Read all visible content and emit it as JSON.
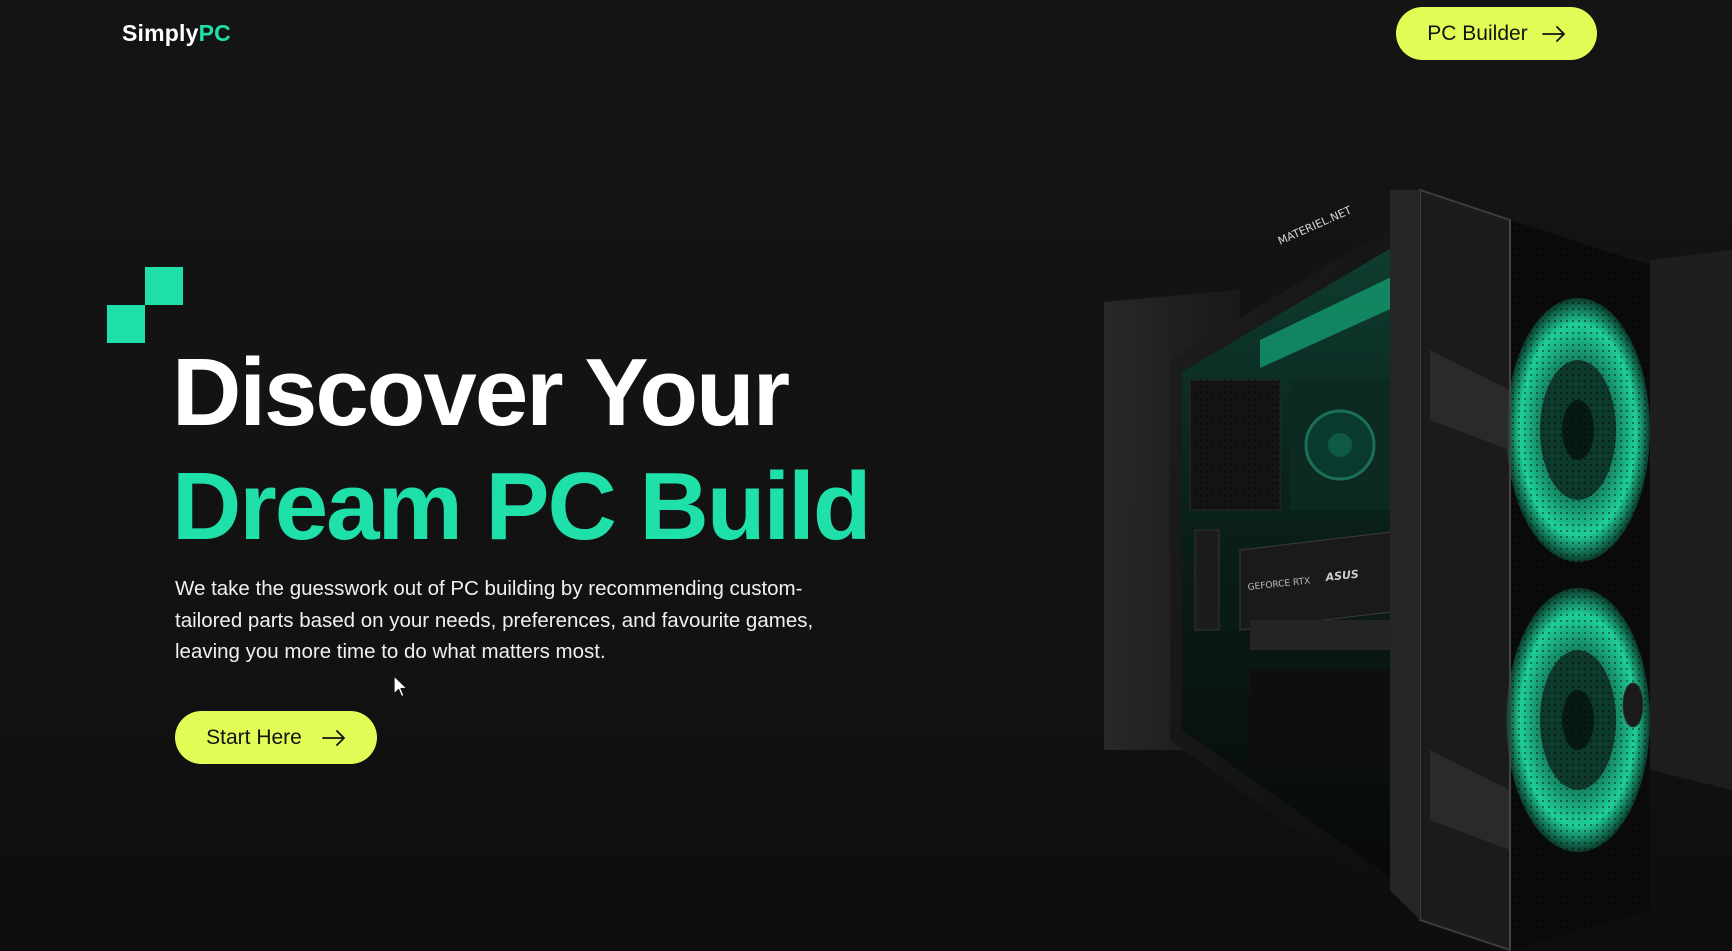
{
  "header": {
    "logo_part1": "Simply",
    "logo_part2": "PC",
    "nav_button_label": "PC Builder"
  },
  "hero": {
    "title_line1": "Discover Your",
    "title_line2": "Dream PC Build",
    "description": "We take the guesswork out of PC building by recommending custom-tailored parts based on your needs, preferences, and favourite games, leaving you more time to do what matters most.",
    "cta_label": "Start Here"
  },
  "pc_image": {
    "top_label": "MATERIEL.NET",
    "gpu_label1": "GEFORCE RTX",
    "gpu_label2": "ASUS"
  },
  "colors": {
    "background": "#131313",
    "accent_green": "#1fe0a8",
    "button_yellow": "#e2fb55",
    "text_white": "#ffffff"
  },
  "icons": {
    "nav_arrow": "arrow-right-icon",
    "cta_arrow": "arrow-right-icon",
    "cursor": "mouse-cursor-icon"
  }
}
